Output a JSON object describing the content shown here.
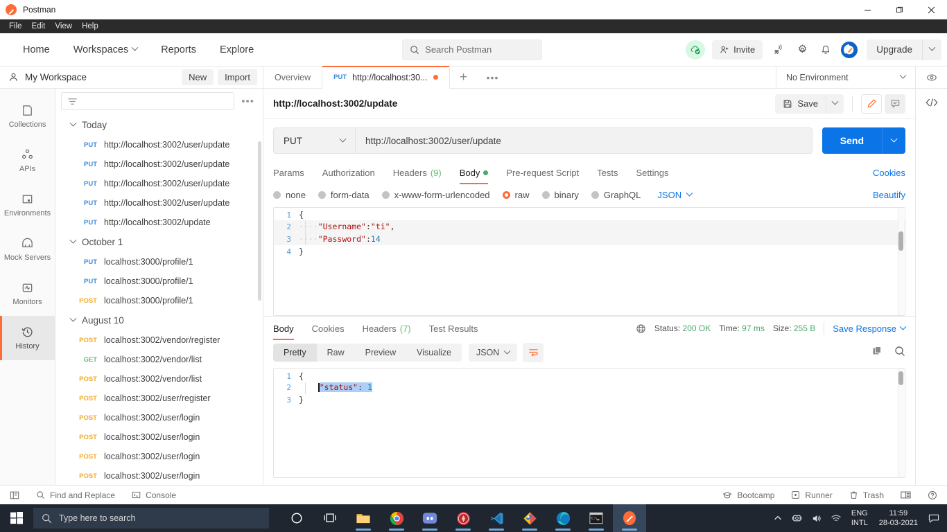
{
  "window": {
    "title": "Postman",
    "logo_icon": "postman-logo-icon",
    "minimize_icon": "minimize-icon",
    "maximize_icon": "maximize-icon",
    "close_icon": "close-icon"
  },
  "menubar": [
    "File",
    "Edit",
    "View",
    "Help"
  ],
  "appheader": {
    "nav": [
      {
        "label": "Home",
        "caret": false
      },
      {
        "label": "Workspaces",
        "caret": true
      },
      {
        "label": "Reports",
        "caret": false
      },
      {
        "label": "Explore",
        "caret": false
      }
    ],
    "search_placeholder": "Search Postman",
    "search_icon": "search-icon",
    "sync_icon": "cloud-sync-ok-icon",
    "invite_label": "Invite",
    "invite_icon": "person-add-icon",
    "satellite_icon": "satellite-antenna-icon",
    "settings_icon": "gear-icon",
    "notifications_icon": "bell-icon",
    "avatar_icon": "user-avatar-icon",
    "upgrade_label": "Upgrade",
    "upgrade_caret_icon": "chevron-down-icon"
  },
  "workspace": {
    "name": "My Workspace",
    "person_icon": "person-icon",
    "new_label": "New",
    "import_label": "Import"
  },
  "rail": [
    {
      "label": "Collections",
      "icon": "collections-icon",
      "active": false
    },
    {
      "label": "APIs",
      "icon": "apis-icon",
      "active": false
    },
    {
      "label": "Environments",
      "icon": "environments-icon",
      "active": false
    },
    {
      "label": "Mock Servers",
      "icon": "mock-servers-icon",
      "active": false
    },
    {
      "label": "Monitors",
      "icon": "monitors-icon",
      "active": false
    },
    {
      "label": "History",
      "icon": "history-clock-icon",
      "active": true
    }
  ],
  "sidebar": {
    "filter_icon": "filter-icon",
    "more_icon": "more-options-icon",
    "groups": [
      {
        "title": "Today",
        "chevron_icon": "chevron-down-icon",
        "items": [
          {
            "method": "PUT",
            "url": "http://localhost:3002/user/update"
          },
          {
            "method": "PUT",
            "url": "http://localhost:3002/user/update"
          },
          {
            "method": "PUT",
            "url": "http://localhost:3002/user/update"
          },
          {
            "method": "PUT",
            "url": "http://localhost:3002/user/update"
          },
          {
            "method": "PUT",
            "url": "http://localhost:3002/update"
          }
        ]
      },
      {
        "title": "October 1",
        "chevron_icon": "chevron-down-icon",
        "items": [
          {
            "method": "PUT",
            "url": "localhost:3000/profile/1"
          },
          {
            "method": "PUT",
            "url": "localhost:3000/profile/1"
          },
          {
            "method": "POST",
            "url": "localhost:3000/profile/1"
          }
        ]
      },
      {
        "title": "August 10",
        "chevron_icon": "chevron-down-icon",
        "items": [
          {
            "method": "POST",
            "url": "localhost:3002/vendor/register"
          },
          {
            "method": "GET",
            "url": "localhost:3002/vendor/list"
          },
          {
            "method": "POST",
            "url": "localhost:3002/vendor/list"
          },
          {
            "method": "POST",
            "url": "localhost:3002/user/register"
          },
          {
            "method": "POST",
            "url": "localhost:3002/user/login"
          },
          {
            "method": "POST",
            "url": "localhost:3002/user/login"
          },
          {
            "method": "POST",
            "url": "localhost:3002/user/login"
          },
          {
            "method": "POST",
            "url": "localhost:3002/user/login"
          }
        ]
      }
    ]
  },
  "tabstrip": {
    "overview_label": "Overview",
    "request_tab": {
      "method": "PUT",
      "label": "http://localhost:30...",
      "unsaved": true
    },
    "plus_icon": "new-tab-icon",
    "more_icon": "tab-more-icon",
    "environment": "No Environment",
    "env_caret_icon": "chevron-down-icon",
    "eye_icon": "eye-icon"
  },
  "request": {
    "title": "http://localhost:3002/update",
    "save_label": "Save",
    "save_icon": "floppy-save-icon",
    "save_caret_icon": "chevron-down-icon",
    "edit_icon": "pencil-edit-icon",
    "comment_icon": "comment-icon",
    "method": "PUT",
    "method_caret_icon": "chevron-down-icon",
    "url": "http://localhost:3002/user/update",
    "send_label": "Send",
    "send_caret_icon": "chevron-down-icon",
    "tabs": [
      {
        "label": "Params",
        "active": false,
        "count": null,
        "dot": false
      },
      {
        "label": "Authorization",
        "active": false,
        "count": null,
        "dot": false
      },
      {
        "label": "Headers",
        "active": false,
        "count": "(9)",
        "dot": false
      },
      {
        "label": "Body",
        "active": true,
        "count": null,
        "dot": true
      },
      {
        "label": "Pre-request Script",
        "active": false,
        "count": null,
        "dot": false
      },
      {
        "label": "Tests",
        "active": false,
        "count": null,
        "dot": false
      },
      {
        "label": "Settings",
        "active": false,
        "count": null,
        "dot": false
      }
    ],
    "cookies_label": "Cookies",
    "body_types": [
      {
        "label": "none",
        "selected": false
      },
      {
        "label": "form-data",
        "selected": false
      },
      {
        "label": "x-www-form-urlencoded",
        "selected": false
      },
      {
        "label": "raw",
        "selected": true
      },
      {
        "label": "binary",
        "selected": false
      },
      {
        "label": "GraphQL",
        "selected": false
      }
    ],
    "format": "JSON",
    "format_caret_icon": "chevron-down-icon",
    "beautify_label": "Beautify",
    "body_lines": [
      {
        "n": "1",
        "text": "{"
      },
      {
        "n": "2",
        "text": "    \"Username\":\"ti\","
      },
      {
        "n": "3",
        "text": "    \"Password\":14"
      },
      {
        "n": "4",
        "text": "}"
      }
    ]
  },
  "response": {
    "tabs": [
      {
        "label": "Body",
        "active": true,
        "count": null
      },
      {
        "label": "Cookies",
        "active": false,
        "count": null
      },
      {
        "label": "Headers",
        "active": false,
        "count": "(7)"
      },
      {
        "label": "Test Results",
        "active": false,
        "count": null
      }
    ],
    "globe_icon": "globe-icon",
    "status_label": "Status:",
    "status_value": "200 OK",
    "time_label": "Time:",
    "time_value": "97 ms",
    "size_label": "Size:",
    "size_value": "255 B",
    "save_response_label": "Save Response",
    "save_response_caret_icon": "chevron-down-icon",
    "view_modes": [
      {
        "label": "Pretty",
        "active": true
      },
      {
        "label": "Raw",
        "active": false
      },
      {
        "label": "Preview",
        "active": false
      },
      {
        "label": "Visualize",
        "active": false
      }
    ],
    "format": "JSON",
    "format_caret_icon": "chevron-down-icon",
    "wrap_icon": "wrap-lines-icon",
    "copy_icon": "copy-icon",
    "search_icon": "search-icon",
    "body_lines": [
      {
        "n": "1",
        "text": "{",
        "selected": false
      },
      {
        "n": "2",
        "text": "    \"status\": 1",
        "selected": true
      },
      {
        "n": "3",
        "text": "}",
        "selected": false
      }
    ]
  },
  "rightrail": {
    "code_icon": "code-snippet-icon"
  },
  "statusbar": {
    "layout_icon": "sidebar-layout-icon",
    "find_replace_label": "Find and Replace",
    "find_replace_icon": "search-icon",
    "console_label": "Console",
    "console_icon": "console-icon",
    "bootcamp_label": "Bootcamp",
    "bootcamp_icon": "graduation-cap-icon",
    "runner_label": "Runner",
    "runner_icon": "runner-icon",
    "trash_label": "Trash",
    "trash_icon": "trash-icon",
    "panels_icon": "two-pane-icon",
    "help_icon": "help-circle-icon"
  },
  "taskbar": {
    "start_icon": "windows-start-icon",
    "search_placeholder": "Type here to search",
    "search_icon": "search-icon",
    "apps": [
      {
        "icon": "cortana-circle-icon",
        "running": false,
        "focus": false
      },
      {
        "icon": "task-view-icon",
        "running": false,
        "focus": false
      },
      {
        "icon": "file-explorer-icon",
        "running": true,
        "focus": false
      },
      {
        "icon": "chrome-icon",
        "running": true,
        "focus": false
      },
      {
        "icon": "discord-icon",
        "running": true,
        "focus": false
      },
      {
        "icon": "game-launcher-icon",
        "running": true,
        "focus": false
      },
      {
        "icon": "vscode-icon",
        "running": true,
        "focus": false
      },
      {
        "icon": "photoshop-diamond-icon",
        "running": true,
        "focus": false
      },
      {
        "icon": "edge-icon",
        "running": true,
        "focus": false
      },
      {
        "icon": "terminal-icon",
        "running": true,
        "focus": false
      },
      {
        "icon": "postman-icon",
        "running": true,
        "focus": true
      }
    ],
    "tray": {
      "chevron_icon": "show-hidden-icons-icon",
      "screen_icon": "screen-cast-icon",
      "volume_icon": "volume-icon",
      "network_icon": "wifi-icon",
      "lang_line1": "ENG",
      "lang_line2": "INTL",
      "time": "11:59",
      "date": "28-03-2021",
      "notification_icon": "action-center-icon"
    }
  },
  "colors": {
    "accent": "#ff6c37",
    "blue": "#0b75e8",
    "green": "#4aa96c",
    "put": "#3b8ad9",
    "post": "#f0ad31",
    "get": "#5ec16f"
  }
}
